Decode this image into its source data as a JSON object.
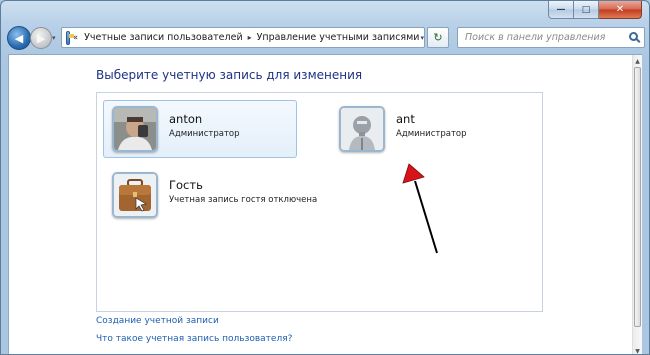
{
  "titlebar": {
    "minimize_glyph": "—",
    "maximize_glyph": "□",
    "close_glyph": "✕"
  },
  "navigation": {
    "back_glyph": "◀",
    "forward_glyph": "▶",
    "history_glyph": "▾",
    "breadcrumb_overflow": "«",
    "breadcrumb_separator": "▸",
    "breadcrumbs": [
      "Учетные записи пользователей",
      "Управление учетными записями"
    ],
    "address_dropdown_glyph": "▾",
    "refresh_glyph": "↻",
    "search_placeholder": "Поиск в панели управления"
  },
  "main": {
    "title": "Выберите учетную запись для изменения",
    "accounts": [
      {
        "name": "anton",
        "role": "Администратор",
        "picture": "photo-avatar-icon",
        "selected": true
      },
      {
        "name": "ant",
        "role": "Администратор",
        "picture": "robot-avatar-icon",
        "selected": false
      },
      {
        "name": "Гость",
        "role": "Учетная запись гостя отключена",
        "picture": "guest-briefcase-icon",
        "selected": false
      }
    ],
    "links": {
      "create_account": "Создание учетной записи",
      "what_is_account": "Что такое учетная запись пользователя?"
    }
  },
  "annotation": {
    "arrow_color": "#d8141a",
    "arrow_shaft_color": "#000000"
  },
  "colors": {
    "title_text": "#1e3287",
    "link_text": "#1d5fb0",
    "selection_border": "#9fc3e6",
    "window_frame": "#b9d1e8"
  }
}
